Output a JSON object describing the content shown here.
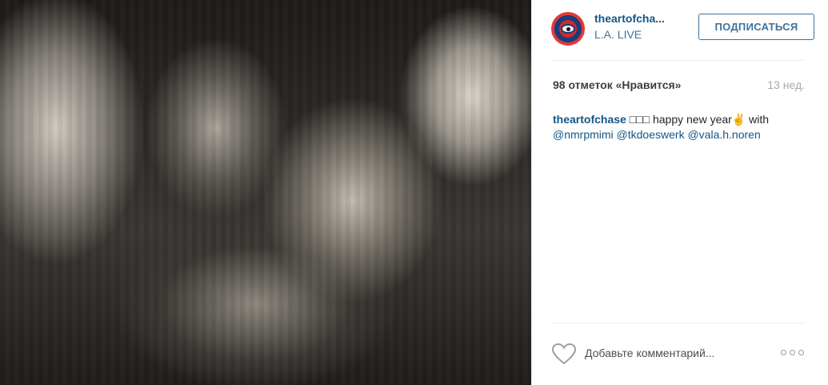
{
  "post": {
    "photo_alt": "",
    "header": {
      "username": "theartofcha...",
      "location": "L.A. LIVE",
      "follow_label": "ПОДПИСАТЬСЯ"
    },
    "stats": {
      "likes": "98 отметок «Нравится»",
      "age": "13 нед."
    },
    "caption": {
      "author": "theartofchase",
      "text": " □□□ happy new year✌ with ",
      "mentions": [
        "@nmrpmimi",
        "@tkdoeswerk",
        "@vala.h.noren"
      ]
    },
    "comment": {
      "placeholder": "Добавьте комментарий..."
    }
  },
  "colors": {
    "link": "#125688",
    "location": "#3f729b",
    "follow_border": "#3f729b",
    "muted": "#a5a7aa"
  },
  "icons": {
    "like": "heart-outline-icon",
    "more": "ellipsis-icon"
  }
}
